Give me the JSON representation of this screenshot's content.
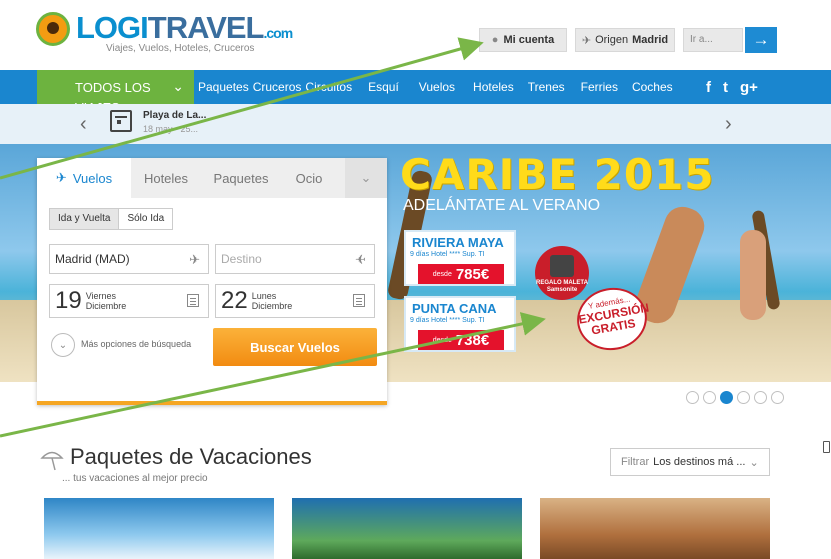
{
  "header": {
    "logo_main": "LOGI",
    "logo_accent": "TRAVEL",
    "logo_domain": ".com",
    "logo_tagline": "Viajes, Vuelos, Hoteles, Cruceros",
    "account_label": "Mi cuenta",
    "origin_prefix": "Origen",
    "origin_value": "Madrid",
    "search_placeholder": "Ir a...",
    "go_glyph": "→"
  },
  "nav": {
    "all_trips_label": "TODOS LOS VIAJES",
    "items": [
      "Paquetes",
      "Cruceros",
      "Circuitos",
      "Esquí",
      "Vuelos",
      "Hoteles",
      "Trenes",
      "Ferries",
      "Coches"
    ],
    "social": [
      "f",
      "t",
      "g+"
    ]
  },
  "strip": {
    "title": "Playa de La...",
    "date": "18 may - 25..."
  },
  "hero": {
    "headline": "CARIBE 2015",
    "subheadline": "ADELÁNTATE AL VERANO",
    "deals": [
      {
        "name": "RIVIERA MAYA",
        "info": "9 días Hotel **** Sup. TI",
        "price_prefix": "desde",
        "price": "785€"
      },
      {
        "name": "PUNTA CANA",
        "info": "9 días Hotel **** Sup. TI",
        "price_prefix": "desde",
        "price": "738€"
      }
    ],
    "bag_promo": "REGALO MALETA Samsonite",
    "excursion_promo_small": "Y además...",
    "excursion_promo_big": "EXCURSIÓN GRATIS",
    "slide_count": 6,
    "active_slide": 3
  },
  "search": {
    "tabs": [
      "Vuelos",
      "Hoteles",
      "Paquetes",
      "Ocio"
    ],
    "active_tab": "Vuelos",
    "trip_types": [
      "Ida y Vuelta",
      "Sólo Ida"
    ],
    "origin_value": "Madrid (MAD)",
    "destination_placeholder": "Destino",
    "depart": {
      "day": "19",
      "weekday": "Viernes",
      "month": "Diciembre"
    },
    "return": {
      "day": "22",
      "weekday": "Lunes",
      "month": "Diciembre"
    },
    "more_options": "Más opciones de búsqueda",
    "submit_label": "Buscar Vuelos"
  },
  "packages": {
    "title": "Paquetes de Vacaciones",
    "subtitle": "... tus vacaciones al mejor precio",
    "filter_label": "Filtrar",
    "filter_value": "Los destinos má ..."
  },
  "colors": {
    "brand_blue": "#1a86cf",
    "brand_green": "#6db33f",
    "accent_orange": "#f28b11",
    "price_red": "#e4122c"
  }
}
